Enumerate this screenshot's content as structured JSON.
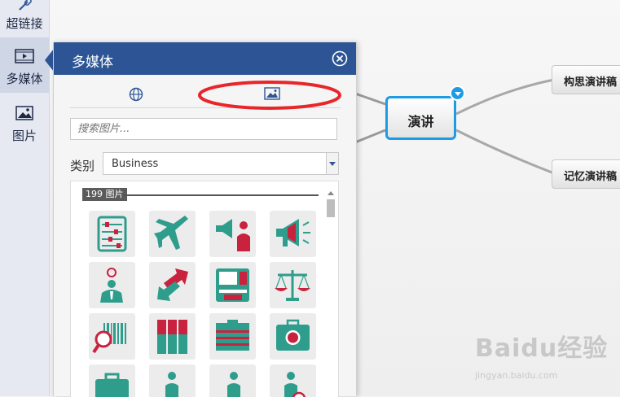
{
  "rail": {
    "items": [
      {
        "label": "超链接",
        "icon": "link-icon"
      },
      {
        "label": "多媒体",
        "icon": "film-icon"
      },
      {
        "label": "图片",
        "icon": "picture-icon"
      }
    ]
  },
  "panel": {
    "title": "多媒体",
    "tabs": [
      {
        "icon": "globe-icon"
      },
      {
        "icon": "image-icon"
      }
    ],
    "search_placeholder": "搜索图片...",
    "category_label": "类别",
    "category_value": "Business",
    "count_label": "199 图片",
    "thumbnails": [
      {
        "icon": "abacus-icon"
      },
      {
        "icon": "airplane-icon"
      },
      {
        "icon": "speaker-person-icon"
      },
      {
        "icon": "megaphone-icon"
      },
      {
        "icon": "idea-person-icon"
      },
      {
        "icon": "arrows-icon"
      },
      {
        "icon": "atm-icon"
      },
      {
        "icon": "scales-icon"
      },
      {
        "icon": "barcode-magnifier-icon"
      },
      {
        "icon": "binders-icon"
      },
      {
        "icon": "cabinet-icon"
      },
      {
        "icon": "money-case-icon"
      },
      {
        "icon": "briefcase-icon"
      },
      {
        "icon": "businessman-icon"
      },
      {
        "icon": "businessman-case-icon"
      },
      {
        "icon": "businessman-money-icon"
      }
    ]
  },
  "mindmap": {
    "center": "演讲",
    "children": [
      "构思演讲稿",
      "记忆演讲稿"
    ]
  },
  "colors": {
    "header": "#2d5596",
    "teal": "#2f9d8c",
    "red": "#c8223f",
    "accent": "#1e9be5",
    "highlight": "#e8262a"
  },
  "watermark": {
    "brand": "Baidu经验",
    "url": "jingyan.baidu.com"
  }
}
